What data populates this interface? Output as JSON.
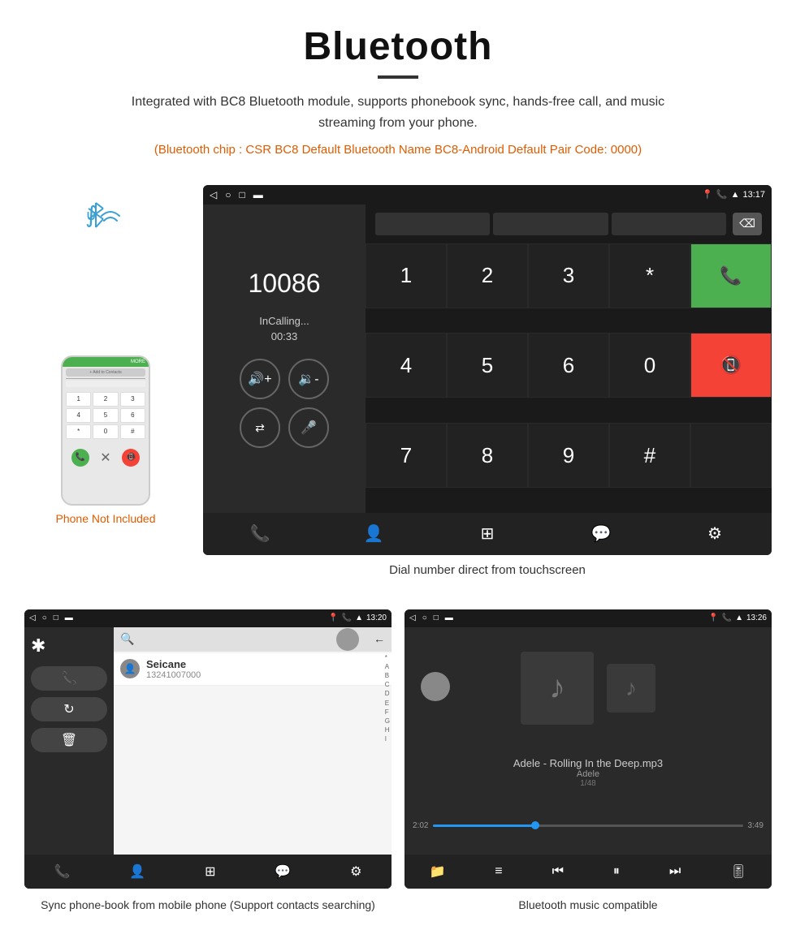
{
  "header": {
    "title": "Bluetooth",
    "description": "Integrated with BC8 Bluetooth module, supports phonebook sync, hands-free call, and music streaming from your phone.",
    "spec": "(Bluetooth chip : CSR BC8    Default Bluetooth Name BC8-Android    Default Pair Code: 0000)"
  },
  "phone": {
    "not_included_label": "Phone Not Included"
  },
  "dial_screen": {
    "status_time": "13:17",
    "number": "10086",
    "calling_status": "InCalling...",
    "timer": "00:33",
    "keys": [
      "1",
      "2",
      "3",
      "*",
      "4",
      "5",
      "6",
      "0",
      "7",
      "8",
      "9",
      "#"
    ],
    "caption": "Dial number direct from touchscreen"
  },
  "phonebook_screen": {
    "status_time": "13:20",
    "contact_name": "Seicane",
    "contact_number": "13241007000",
    "alphabet": [
      "*",
      "A",
      "B",
      "C",
      "D",
      "E",
      "F",
      "G",
      "H",
      "I"
    ],
    "caption": "Sync phone-book from mobile phone\n(Support contacts searching)"
  },
  "music_screen": {
    "status_time": "13:26",
    "song_title": "Adele - Rolling In the Deep.mp3",
    "artist": "Adele",
    "track_info": "1/48",
    "time_current": "2:02",
    "time_total": "3:49",
    "caption": "Bluetooth music compatible"
  }
}
